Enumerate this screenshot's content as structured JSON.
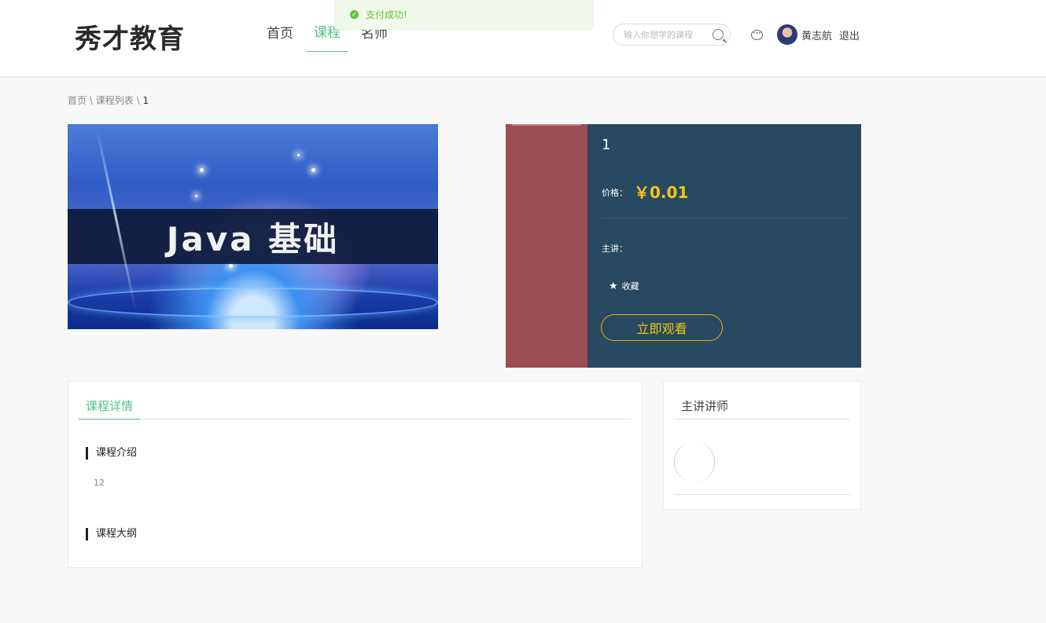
{
  "header": {
    "logo": "秀才教育",
    "nav": [
      {
        "label": "首页",
        "active": false
      },
      {
        "label": "课程",
        "active": true
      },
      {
        "label": "名师",
        "active": false
      }
    ],
    "search": {
      "placeholder": "输入你想学的课程"
    },
    "username": "黄志航",
    "logout": "退出"
  },
  "toast": {
    "message": "支付成功!",
    "color": "#67c23a"
  },
  "breadcrumb": {
    "home": "首页",
    "list": "课程列表",
    "current": "1",
    "separator": "\\"
  },
  "banner": {
    "text": "Java 基础"
  },
  "course": {
    "title": "1",
    "price_label": "价格：",
    "price": "￥0.01",
    "teacher_label": "主讲：",
    "favorite": "收藏",
    "watch_button": "立即观看"
  },
  "details": {
    "tab": "课程详情",
    "intro_title": "课程介绍",
    "intro_text": "12",
    "outline_title": "课程大纲"
  },
  "teacher_panel": {
    "title": "主讲讲师"
  },
  "colors": {
    "accent": "#53c08b",
    "panel": "#274962",
    "price": "#f5c518",
    "side": "#9c4f52"
  }
}
